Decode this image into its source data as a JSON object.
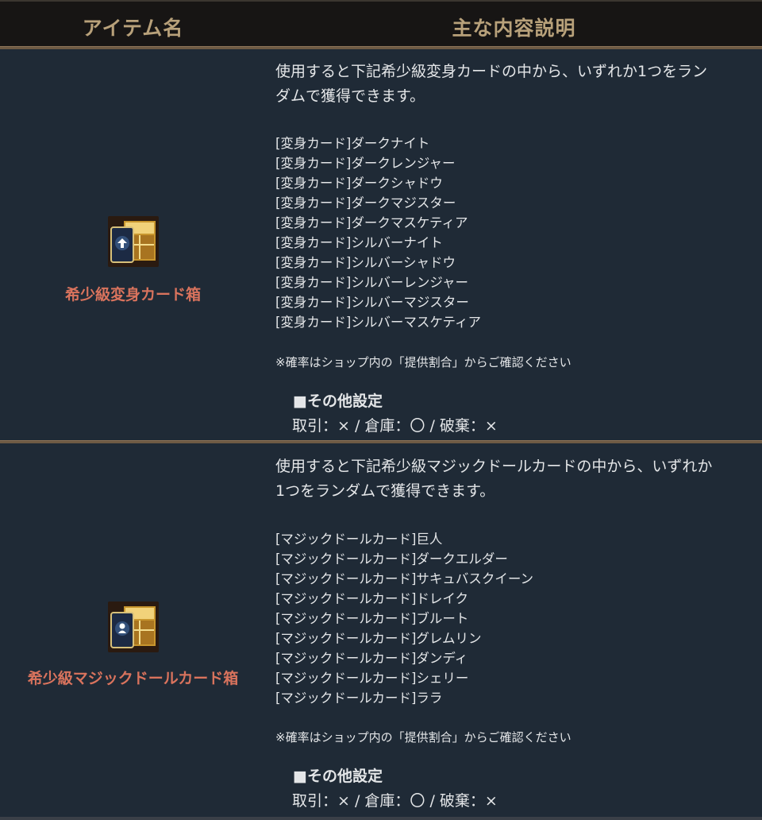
{
  "header": {
    "name_col": "アイテム名",
    "desc_col": "主な内容説明"
  },
  "colors": {
    "background": "#1f2a36",
    "header_bg": "#171514",
    "header_text": "#b8a17a",
    "item_name": "#d9735d",
    "separator": "#6e5a44",
    "text": "#e4e6e8"
  },
  "rows": [
    {
      "icon": "card-box-icon",
      "name": "希少級変身カード箱",
      "intro_line1": "使用すると下記希少級変身カードの中から、いずれか1つをラン",
      "intro_line2": "ダムで獲得できます。",
      "items": [
        "[変身カード]ダークナイト",
        "[変身カード]ダークレンジャー",
        "[変身カード]ダークシャドウ",
        "[変身カード]ダークマジスター",
        "[変身カード]ダークマスケティア",
        "[変身カード]シルバーナイト",
        "[変身カード]シルバーシャドウ",
        "[変身カード]シルバーレンジャー",
        "[変身カード]シルバーマジスター",
        "[変身カード]シルバーマスケティア"
      ],
      "note": "※確率はショップ内の「提供割合」からご確認ください",
      "other_title": "■その他設定",
      "other_body": "取引：× / 倉庫：〇 / 破棄：×"
    },
    {
      "icon": "doll-card-box-icon",
      "name": "希少級マジックドールカード箱",
      "intro_line1": "使用すると下記希少級マジックドールカードの中から、いずれか",
      "intro_line2": "1つをランダムで獲得できます。",
      "items": [
        "[マジックドールカード]巨人",
        "[マジックドールカード]ダークエルダー",
        "[マジックドールカード]サキュバスクイーン",
        "[マジックドールカード]ドレイク",
        "[マジックドールカード]ブルート",
        "[マジックドールカード]グレムリン",
        "[マジックドールカード]ダンディ",
        "[マジックドールカード]シェリー",
        "[マジックドールカード]ララ"
      ],
      "note": "※確率はショップ内の「提供割合」からご確認ください",
      "other_title": "■その他設定",
      "other_body": "取引：× / 倉庫：〇 / 破棄：×"
    }
  ]
}
